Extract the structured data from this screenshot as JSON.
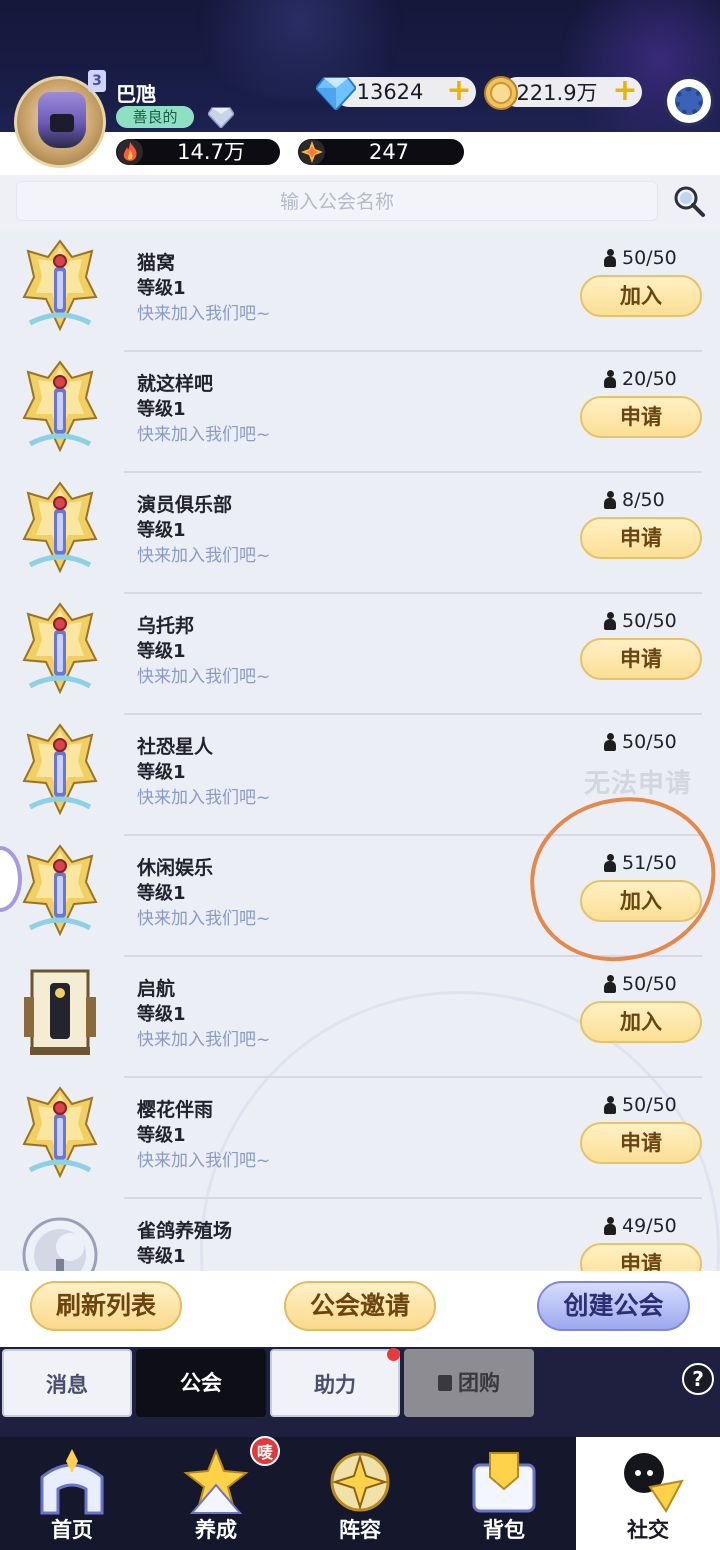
{
  "player": {
    "name": "巴虺",
    "level": "3",
    "tag": "善良的"
  },
  "resources": {
    "diamonds": "13624",
    "coins": "221.9万",
    "power": "14.7万",
    "stars": "247"
  },
  "search": {
    "placeholder": "输入公会名称"
  },
  "guilds": [
    {
      "name": "猫窝",
      "level": "等级1",
      "desc": "快来加入我们吧~",
      "members": "50/50",
      "action": "加入",
      "emblem": "gold-crest-icon"
    },
    {
      "name": "就这样吧",
      "level": "等级1",
      "desc": "快来加入我们吧~",
      "members": "20/50",
      "action": "申请",
      "emblem": "gold-crest-icon"
    },
    {
      "name": "演员俱乐部",
      "level": "等级1",
      "desc": "快来加入我们吧~",
      "members": "8/50",
      "action": "申请",
      "emblem": "gold-crest-icon"
    },
    {
      "name": "乌托邦",
      "level": "等级1",
      "desc": "快来加入我们吧~",
      "members": "50/50",
      "action": "申请",
      "emblem": "gold-crest-icon"
    },
    {
      "name": "社恐星人",
      "level": "等级1",
      "desc": "快来加入我们吧~",
      "members": "50/50",
      "action": "无法申请",
      "emblem": "gold-crest-icon"
    },
    {
      "name": "休闲娱乐",
      "level": "等级1",
      "desc": "快来加入我们吧~",
      "members": "51/50",
      "action": "加入",
      "emblem": "gold-crest-icon"
    },
    {
      "name": "启航",
      "level": "等级1",
      "desc": "快来加入我们吧~",
      "members": "50/50",
      "action": "加入",
      "emblem": "throne-crest-icon"
    },
    {
      "name": "樱花伴雨",
      "level": "等级1",
      "desc": "快来加入我们吧~",
      "members": "50/50",
      "action": "申请",
      "emblem": "gold-crest-icon"
    },
    {
      "name": "雀鸽养殖场",
      "level": "等级1",
      "desc": "",
      "members": "49/50",
      "action": "申请",
      "emblem": "moon-crest-icon"
    }
  ],
  "actions": {
    "refresh": "刷新列表",
    "invite": "公会邀请",
    "create": "创建公会"
  },
  "subtabs": {
    "messages": "消息",
    "guild": "公会",
    "assist": "助力",
    "group_buy": "团购"
  },
  "nav": {
    "home": "首页",
    "train": "养成",
    "lineup": "阵容",
    "bag": "背包",
    "social": "社交",
    "train_badge": "唛"
  },
  "help_label": "?",
  "colors": {
    "button_gold": "#fbdf95",
    "button_purple": "#9ea8ee",
    "annotation": "#e5884a",
    "header_bg": "#1a1f4a"
  }
}
